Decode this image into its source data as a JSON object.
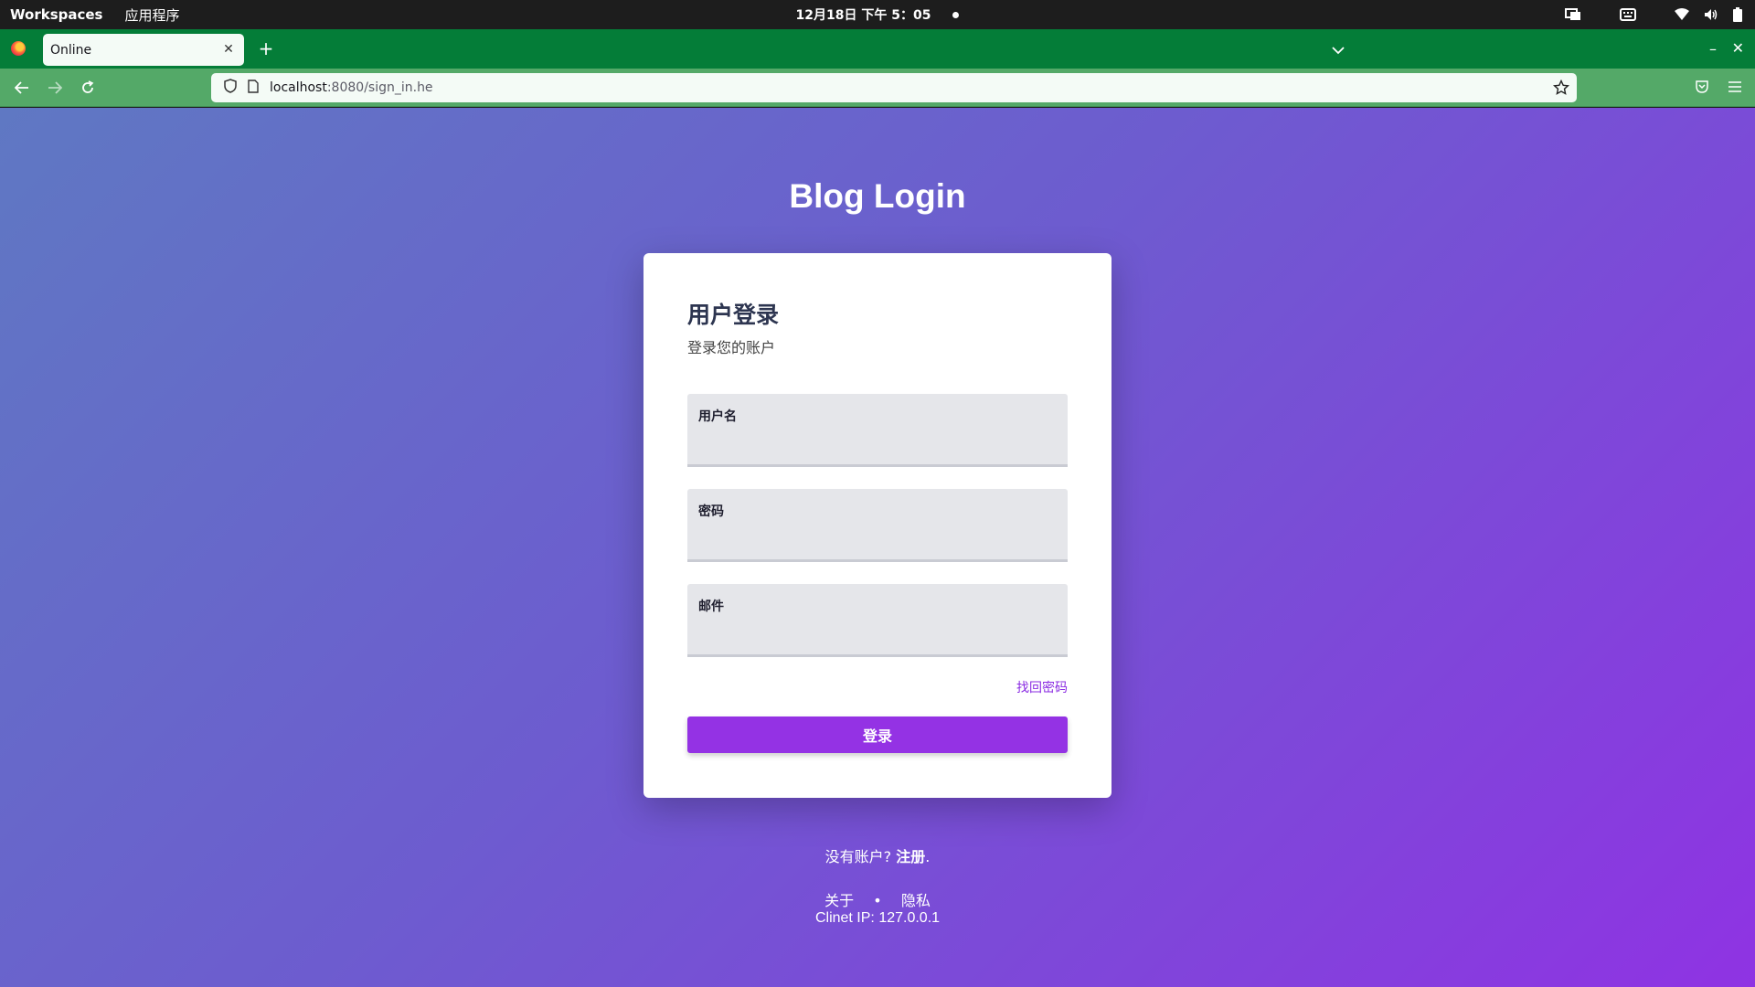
{
  "topbar": {
    "workspaces": "Workspaces",
    "apps": "应用程序",
    "clock": "12月18日  下午 5：05"
  },
  "browser": {
    "tab_title": "Online",
    "url_host": "localhost",
    "url_path": ":8080/sign_in.he"
  },
  "page": {
    "title": "Blog Login",
    "card": {
      "title": "用户登录",
      "subtitle": "登录您的账户",
      "fields": [
        {
          "label": "用户名",
          "value": ""
        },
        {
          "label": "密码",
          "value": ""
        },
        {
          "label": "邮件",
          "value": ""
        }
      ],
      "forgot_link": "找回密码",
      "login_button": "登录"
    },
    "footer": {
      "no_account": "没有账户? ",
      "register": "注册",
      "register_suffix": ".",
      "about": "关于",
      "separator": "•",
      "privacy": "隐私",
      "client_ip": "Clinet IP: 127.0.0.1"
    }
  },
  "colors": {
    "tabstrip": "#047d38",
    "navbar": "#54a968",
    "gradient_start": "#5f78c3",
    "gradient_end": "#8f33e3",
    "accent": "#9432e4"
  }
}
